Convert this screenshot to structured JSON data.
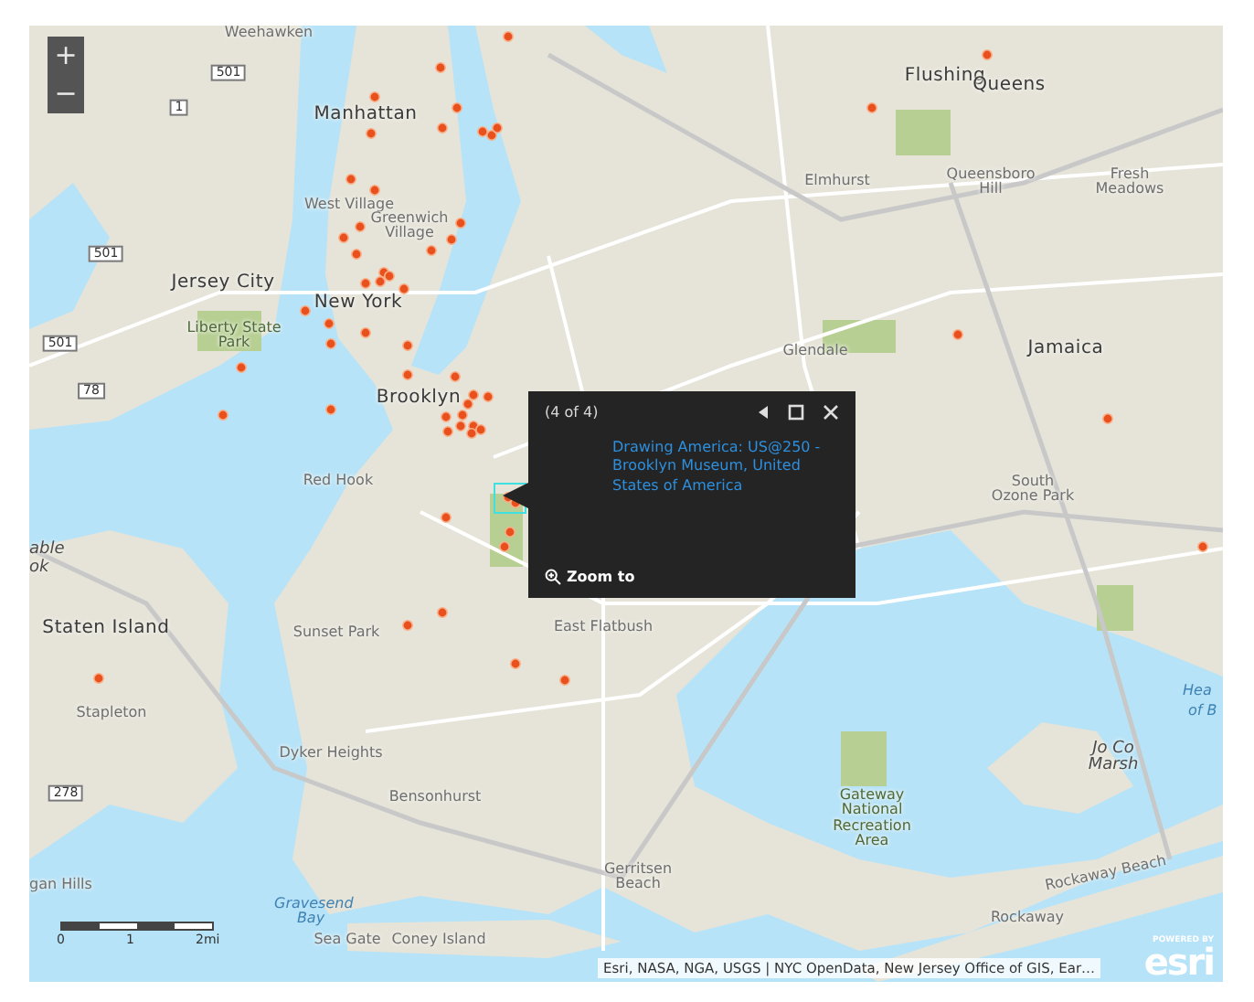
{
  "map": {
    "zoom_controls": [
      "+",
      "−"
    ],
    "labels": [
      {
        "text": "Weehawken",
        "kind": "place"
      },
      {
        "text": "Manhattan",
        "kind": "major"
      },
      {
        "text": "Flushing",
        "kind": "major"
      },
      {
        "text": "Queens",
        "kind": "major"
      },
      {
        "text": "Elmhurst",
        "kind": "place"
      },
      {
        "text": "Queensboro Hill",
        "kind": "place"
      },
      {
        "text": "Fresh Meadows",
        "kind": "place"
      },
      {
        "text": "West Village",
        "kind": "place"
      },
      {
        "text": "Greenwich Village",
        "kind": "place"
      },
      {
        "text": "Jersey City",
        "kind": "major"
      },
      {
        "text": "New York",
        "kind": "major"
      },
      {
        "text": "Liberty State Park",
        "kind": "park"
      },
      {
        "text": "Glendale",
        "kind": "place"
      },
      {
        "text": "Jamaica",
        "kind": "major"
      },
      {
        "text": "Brooklyn",
        "kind": "major"
      },
      {
        "text": "Red Hook",
        "kind": "place"
      },
      {
        "text": "South Ozone Park",
        "kind": "place"
      },
      {
        "text": "able",
        "kind": "italic"
      },
      {
        "text": "ok",
        "kind": "italic"
      },
      {
        "text": "Staten Island",
        "kind": "major"
      },
      {
        "text": "East Flatbush",
        "kind": "place"
      },
      {
        "text": "Sunset Park",
        "kind": "place"
      },
      {
        "text": "Stapleton",
        "kind": "place"
      },
      {
        "text": "Dyker Heights",
        "kind": "place"
      },
      {
        "text": "Bensonhurst",
        "kind": "place"
      },
      {
        "text": "Gateway National Recreation Area",
        "kind": "park"
      },
      {
        "text": "Jo Co Marsh",
        "kind": "italic"
      },
      {
        "text": "Hea",
        "kind": "water"
      },
      {
        "text": "of B",
        "kind": "water"
      },
      {
        "text": "Gerritsen Beach",
        "kind": "place"
      },
      {
        "text": "Gravesend Bay",
        "kind": "water"
      },
      {
        "text": "Sea Gate",
        "kind": "place"
      },
      {
        "text": "Coney Island",
        "kind": "place"
      },
      {
        "text": "Rockaway",
        "kind": "place"
      },
      {
        "text": "Rockaway Beach",
        "kind": "place"
      },
      {
        "text": "gan Hills",
        "kind": "place"
      },
      {
        "text": "501",
        "kind": "shield"
      },
      {
        "text": "1",
        "kind": "shield"
      },
      {
        "text": "501",
        "kind": "shield"
      },
      {
        "text": "501",
        "kind": "shield"
      },
      {
        "text": "78",
        "kind": "shield"
      },
      {
        "text": "278",
        "kind": "shield"
      }
    ],
    "scale": [
      "0",
      "1",
      "2mi"
    ],
    "attribution": "Esri, NASA, NGA, USGS | NYC OpenData, New Jersey Office of GIS, Ear…",
    "logo": {
      "tagline": "POWERED BY",
      "name": "esri"
    }
  },
  "popup": {
    "counter": "(4 of 4)",
    "title": "Drawing America: US@250 - Brooklyn Museum, United States of America",
    "action": "Zoom to"
  }
}
